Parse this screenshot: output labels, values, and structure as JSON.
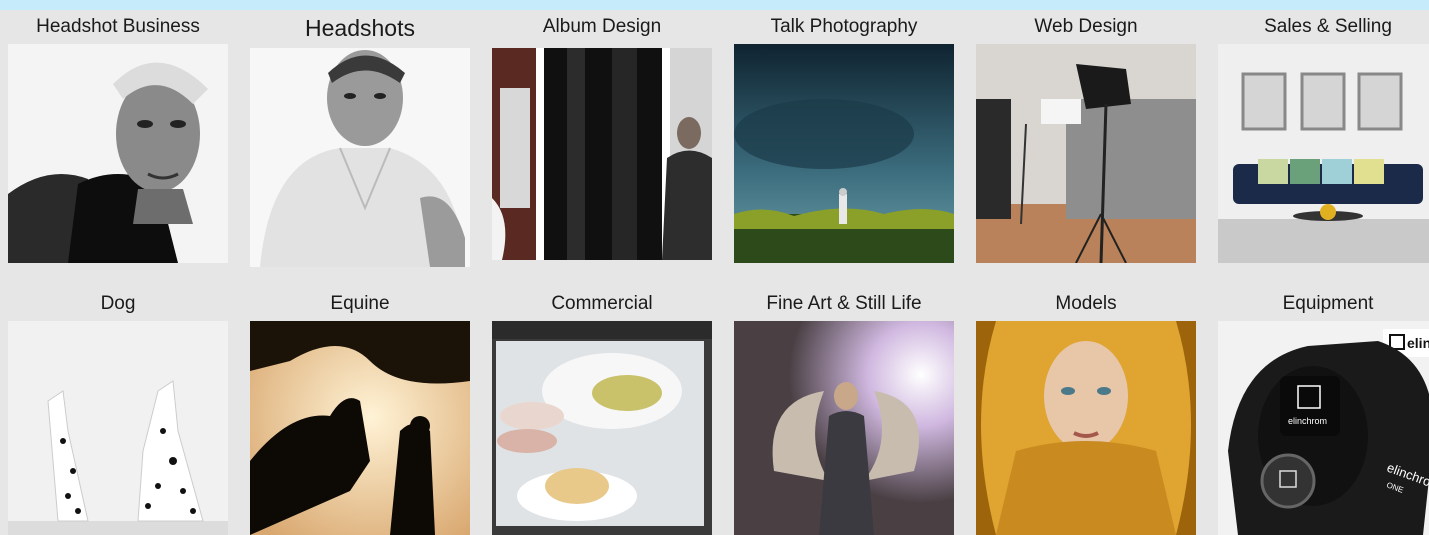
{
  "gallery": {
    "row1": [
      {
        "label": "Headshot Business"
      },
      {
        "label": "Headshots"
      },
      {
        "label": "Album Design"
      },
      {
        "label": "Talk Photography"
      },
      {
        "label": "Web Design"
      },
      {
        "label": "Sales & Selling"
      }
    ],
    "row2": [
      {
        "label": "Dog"
      },
      {
        "label": "Equine"
      },
      {
        "label": "Commercial"
      },
      {
        "label": "Fine Art & Still Life"
      },
      {
        "label": "Models"
      },
      {
        "label": "Equipment"
      }
    ]
  },
  "equipment_brand_text": "elinchrom",
  "equipment_model_text": "ONE",
  "colors": {
    "page_background": "#c6ecfb",
    "panel_background": "#e6e6e6"
  }
}
